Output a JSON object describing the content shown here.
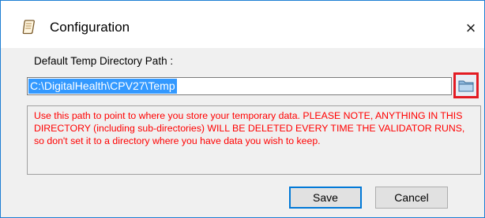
{
  "window": {
    "title": "Configuration",
    "icon": "document-icon",
    "close_glyph": "×"
  },
  "form": {
    "path_label": "Default Temp Directory Path :",
    "path_value": "C:\\DigitalHealth\\CPV27\\Temp",
    "browse_icon": "folder-icon",
    "warning": "Use this path to point to where you store your temporary data. PLEASE NOTE, ANYTHING IN THIS DIRECTORY (including sub-directories) WILL BE DELETED EVERY TIME THE VALIDATOR RUNS, so don't set it to a directory where you have data you wish to keep."
  },
  "buttons": {
    "save": "Save",
    "cancel": "Cancel"
  },
  "colors": {
    "warning_text": "#ff0000",
    "selection": "#3399ff",
    "highlight_border": "#e31b23",
    "default_button_border": "#0078d7"
  }
}
